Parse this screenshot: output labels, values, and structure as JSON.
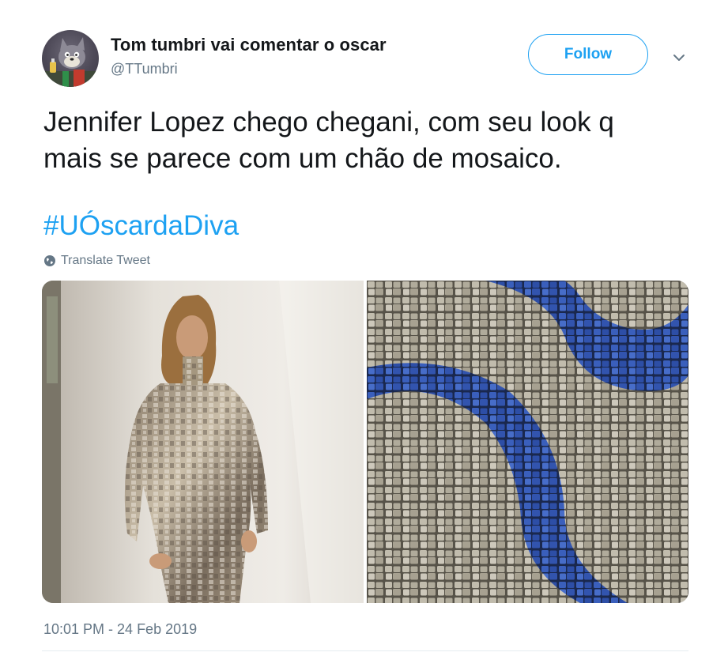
{
  "author": {
    "name": "Tom tumbri vai comentar o oscar",
    "handle": "@TTumbri",
    "avatar_icon": "cartoon-cat-avatar"
  },
  "actions": {
    "follow_label": "Follow",
    "menu_icon": "chevron-down-icon"
  },
  "tweet": {
    "text_line1": "Jennifer Lopez chego chegani, com seu look q",
    "text_line2": "mais se parece com um chão de mosaico.",
    "hashtag": "#UÓscardaDiva",
    "translate_label": "Translate Tweet",
    "timestamp": "10:01 PM - 24 Feb 2019"
  },
  "colors": {
    "accent": "#1da1f2",
    "secondary_text": "#657786",
    "primary_text": "#14171a"
  }
}
